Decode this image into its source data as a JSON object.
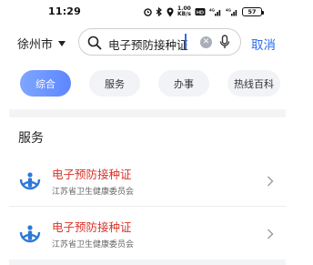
{
  "status_bar": {
    "time": "11:29",
    "network_speed": "1.00\nKB/s",
    "signal_label_1": "4G",
    "signal_label_2": "4G",
    "battery": "57"
  },
  "search": {
    "city": "徐州市",
    "query": "电子预防接种证",
    "cancel_label": "取消"
  },
  "tabs": [
    {
      "label": "综合",
      "active": true
    },
    {
      "label": "服务",
      "active": false
    },
    {
      "label": "办事",
      "active": false
    },
    {
      "label": "热线百科",
      "active": false
    }
  ],
  "section": {
    "title": "服务"
  },
  "results": [
    {
      "title": "电子预防接种证",
      "subtitle": "江苏省卫生健康委员会"
    },
    {
      "title": "电子预防接种证",
      "subtitle": "江苏省卫生健康委员会"
    }
  ],
  "colors": {
    "accent": "#2c6df0",
    "result_title": "#d9342b",
    "tab_active": "#6b93ff"
  }
}
